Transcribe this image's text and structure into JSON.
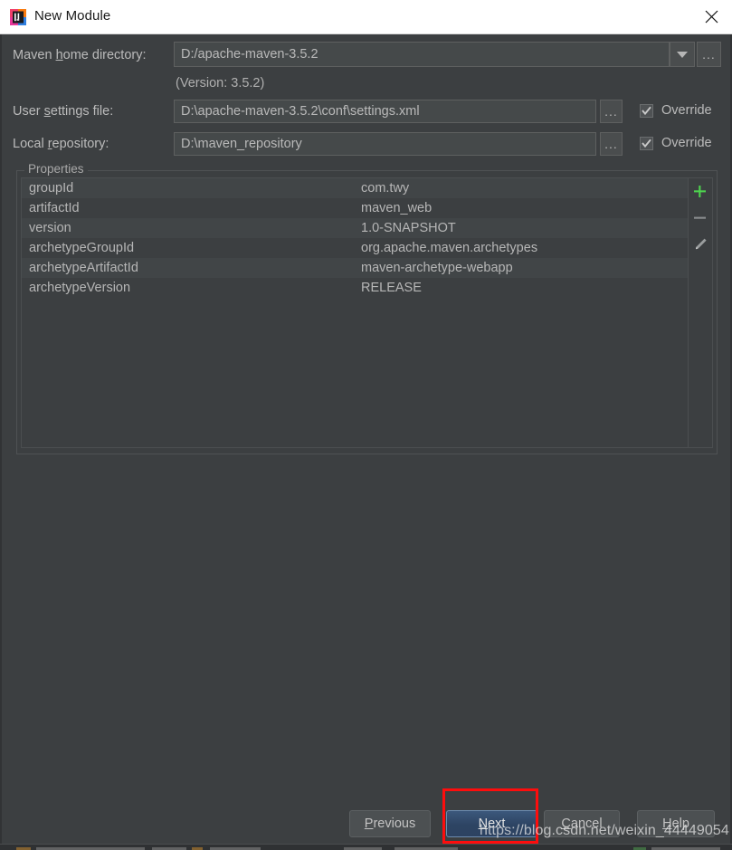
{
  "window": {
    "title": "New Module",
    "app_icon": "intellij-idea-icon",
    "close_icon": "close-icon"
  },
  "form": {
    "maven_home": {
      "label_pre": "Maven ",
      "label_mnemonic": "h",
      "label_post": "ome directory:",
      "value": "D:/apache-maven-3.5.2",
      "dropdown_icon": "chevron-down-icon",
      "browse_label": "...",
      "version_note": "(Version: 3.5.2)"
    },
    "user_settings": {
      "label_pre": "User ",
      "label_mnemonic": "s",
      "label_post": "ettings file:",
      "value": "D:\\apache-maven-3.5.2\\conf\\settings.xml",
      "browse_label": "...",
      "override_label": "Override",
      "override_checked": true
    },
    "local_repository": {
      "label_pre": "Local ",
      "label_mnemonic": "r",
      "label_post": "epository:",
      "value": "D:\\maven_repository",
      "browse_label": "...",
      "override_label": "Override",
      "override_checked": true
    }
  },
  "properties": {
    "legend": "Properties",
    "rows": [
      {
        "key": "groupId",
        "value": "com.twy"
      },
      {
        "key": "artifactId",
        "value": "maven_web"
      },
      {
        "key": "version",
        "value": "1.0-SNAPSHOT"
      },
      {
        "key": "archetypeGroupId",
        "value": "org.apache.maven.archetypes"
      },
      {
        "key": "archetypeArtifactId",
        "value": "maven-archetype-webapp"
      },
      {
        "key": "archetypeVersion",
        "value": "RELEASE"
      }
    ],
    "toolbar": {
      "add_icon": "plus-icon",
      "remove_icon": "minus-icon",
      "edit_icon": "pencil-icon",
      "add_color": "#4ed44e",
      "remove_color": "#8a8d8e",
      "edit_color": "#9a9d9e"
    }
  },
  "footer": {
    "previous": {
      "pre": "",
      "mnemonic": "P",
      "post": "revious"
    },
    "next": {
      "pre": "",
      "mnemonic": "N",
      "post": "ext"
    },
    "cancel": {
      "pre": "",
      "mnemonic": "C",
      "post": "ancel"
    },
    "help": {
      "pre": "",
      "mnemonic": "H",
      "post": "elp"
    }
  },
  "watermark": "https://blog.csdn.net/weixin_44449054",
  "colors": {
    "dialog_bg": "#3c3f41",
    "titlebar_bg": "#ffffff",
    "text": "#bbbbbb",
    "primary_button": "#30486a",
    "annotation_red": "#fd0d0d",
    "add_green": "#4ed44e"
  }
}
